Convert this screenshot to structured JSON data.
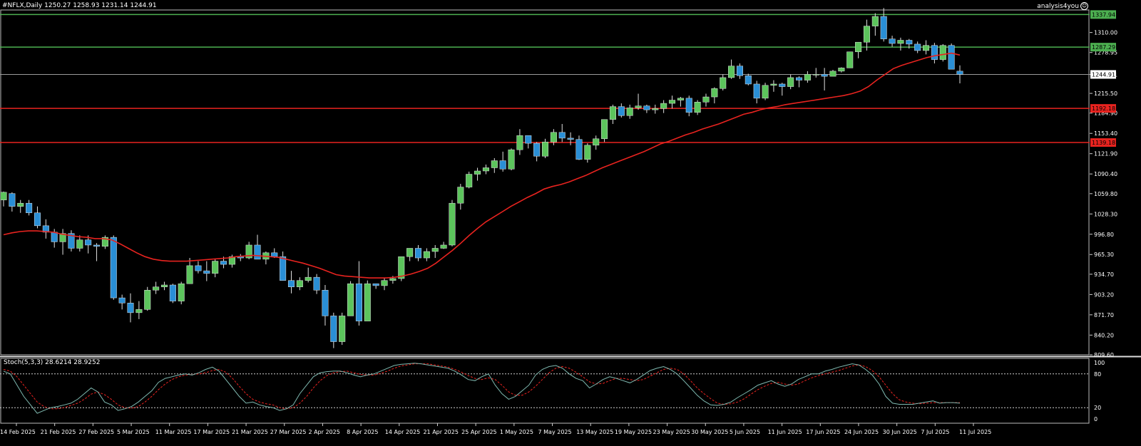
{
  "header": {
    "symbol_label": "#NFLX,Daily",
    "ohlc": "1250.27 1258.93 1231.14 1244.91",
    "brand": "analysis4you",
    "brand_icon": "smiley-icon"
  },
  "colors": {
    "background": "#000000",
    "bull_candle": "#5cc45c",
    "bear_candle": "#2a8fd6",
    "ma_line": "#e8231f",
    "support_line": "#e8231f",
    "resistance_line": "#4caf50",
    "current_price_line": "#9a9a9a",
    "stoch_main": "#7fb9b0",
    "stoch_signal": "#e8231f",
    "grid_dotted": "#cfcfcf"
  },
  "chart_data": [
    {
      "type": "candlestick",
      "title": "#NFLX,Daily",
      "ylim": [
        809.6,
        1345
      ],
      "y_ticks": [
        "1310.00",
        "1278.95",
        "1244.91",
        "1215.50",
        "1184.90",
        "1153.40",
        "1121.90",
        "1090.40",
        "1059.80",
        "1028.30",
        "996.80",
        "965.30",
        "934.70",
        "903.20",
        "871.70",
        "840.20",
        "809.60"
      ],
      "horizontal_levels": [
        {
          "label": "1337.94",
          "value": 1337.94,
          "role": "resistance"
        },
        {
          "label": "1287.29",
          "value": 1287.29,
          "role": "resistance"
        },
        {
          "label": "1244.91",
          "value": 1244.91,
          "role": "current"
        },
        {
          "label": "1192.18",
          "value": 1192.18,
          "role": "support"
        },
        {
          "label": "1139.18",
          "value": 1139.18,
          "role": "support"
        }
      ],
      "x_labels": [
        "14 Feb 2025",
        "21 Feb 2025",
        "27 Feb 2025",
        "5 Mar 2025",
        "11 Mar 2025",
        "17 Mar 2025",
        "21 Mar 2025",
        "27 Mar 2025",
        "2 Apr 2025",
        "8 Apr 2025",
        "14 Apr 2025",
        "21 Apr 2025",
        "25 Apr 2025",
        "1 May 2025",
        "7 May 2025",
        "13 May 2025",
        "19 May 2025",
        "23 May 2025",
        "30 May 2025",
        "5 Jun 2025",
        "11 Jun 2025",
        "17 Jun 2025",
        "24 Jun 2025",
        "30 Jun 2025",
        "7 Jul 2025",
        "11 Jul 2025"
      ],
      "candles": [
        [
          1050,
          1063,
          1040,
          1062
        ],
        [
          1060,
          1062,
          1032,
          1040
        ],
        [
          1040,
          1050,
          1030,
          1045
        ],
        [
          1045,
          1050,
          1026,
          1030
        ],
        [
          1030,
          1040,
          1006,
          1010
        ],
        [
          1010,
          1020,
          990,
          1000
        ],
        [
          1000,
          1005,
          976,
          985
        ],
        [
          985,
          1005,
          965,
          998
        ],
        [
          998,
          1003,
          970,
          975
        ],
        [
          975,
          995,
          970,
          988
        ],
        [
          988,
          995,
          967,
          980
        ],
        [
          980,
          983,
          955,
          978
        ],
        [
          978,
          995,
          974,
          992
        ],
        [
          992,
          995,
          895,
          898
        ],
        [
          898,
          903,
          880,
          890
        ],
        [
          890,
          905,
          860,
          875
        ],
        [
          875,
          893,
          865,
          880
        ],
        [
          880,
          915,
          878,
          910
        ],
        [
          910,
          923,
          904,
          915
        ],
        [
          915,
          923,
          910,
          918
        ],
        [
          918,
          920,
          890,
          893
        ],
        [
          893,
          923,
          888,
          920
        ],
        [
          920,
          960,
          920,
          948
        ],
        [
          948,
          955,
          936,
          940
        ],
        [
          940,
          955,
          924,
          936
        ],
        [
          936,
          958,
          930,
          955
        ],
        [
          955,
          962,
          944,
          950
        ],
        [
          950,
          965,
          945,
          962
        ],
        [
          962,
          966,
          955,
          960
        ],
        [
          960,
          985,
          958,
          980
        ],
        [
          980,
          996,
          958,
          958
        ],
        [
          958,
          970,
          950,
          968
        ],
        [
          968,
          975,
          960,
          962
        ],
        [
          962,
          970,
          925,
          925
        ],
        [
          925,
          940,
          905,
          915
        ],
        [
          915,
          930,
          910,
          925
        ],
        [
          925,
          945,
          922,
          930
        ],
        [
          930,
          935,
          904,
          910
        ],
        [
          910,
          918,
          855,
          870
        ],
        [
          870,
          875,
          820,
          830
        ],
        [
          830,
          875,
          825,
          870
        ],
        [
          870,
          924,
          870,
          920
        ],
        [
          920,
          955,
          855,
          862
        ],
        [
          862,
          925,
          910,
          920
        ],
        [
          920,
          920,
          912,
          917
        ],
        [
          917,
          929,
          910,
          925
        ],
        [
          925,
          932,
          920,
          928
        ],
        [
          928,
          960,
          924,
          962
        ],
        [
          962,
          975,
          955,
          975
        ],
        [
          975,
          980,
          955,
          960
        ],
        [
          960,
          975,
          955,
          970
        ],
        [
          970,
          980,
          960,
          975
        ],
        [
          975,
          985,
          974,
          980
        ],
        [
          980,
          1050,
          978,
          1045
        ],
        [
          1045,
          1075,
          1035,
          1070
        ],
        [
          1070,
          1094,
          1068,
          1090
        ],
        [
          1090,
          1100,
          1080,
          1095
        ],
        [
          1095,
          1105,
          1090,
          1100
        ],
        [
          1100,
          1115,
          1092,
          1111
        ],
        [
          1111,
          1125,
          1094,
          1098
        ],
        [
          1098,
          1130,
          1096,
          1128
        ],
        [
          1128,
          1160,
          1120,
          1150
        ],
        [
          1150,
          1145,
          1130,
          1138
        ],
        [
          1138,
          1140,
          1110,
          1118
        ],
        [
          1118,
          1145,
          1115,
          1140
        ],
        [
          1140,
          1160,
          1135,
          1155
        ],
        [
          1155,
          1168,
          1140,
          1146
        ],
        [
          1146,
          1155,
          1135,
          1144
        ],
        [
          1144,
          1150,
          1112,
          1113
        ],
        [
          1113,
          1138,
          1108,
          1135
        ],
        [
          1135,
          1150,
          1128,
          1145
        ],
        [
          1145,
          1175,
          1140,
          1175
        ],
        [
          1175,
          1198,
          1168,
          1195
        ],
        [
          1195,
          1200,
          1178,
          1181
        ],
        [
          1181,
          1198,
          1176,
          1193
        ],
        [
          1193,
          1215,
          1190,
          1196
        ],
        [
          1196,
          1198,
          1185,
          1190
        ],
        [
          1190,
          1198,
          1184,
          1192
        ],
        [
          1192,
          1205,
          1185,
          1200
        ],
        [
          1200,
          1212,
          1192,
          1205
        ],
        [
          1205,
          1210,
          1195,
          1208
        ],
        [
          1208,
          1212,
          1180,
          1186
        ],
        [
          1186,
          1205,
          1182,
          1202
        ],
        [
          1202,
          1215,
          1195,
          1210
        ],
        [
          1210,
          1225,
          1200,
          1223
        ],
        [
          1223,
          1245,
          1220,
          1240
        ],
        [
          1240,
          1268,
          1238,
          1258
        ],
        [
          1258,
          1262,
          1238,
          1243
        ],
        [
          1243,
          1246,
          1228,
          1230
        ],
        [
          1230,
          1235,
          1200,
          1208
        ],
        [
          1208,
          1232,
          1205,
          1228
        ],
        [
          1228,
          1236,
          1218,
          1230
        ],
        [
          1230,
          1232,
          1212,
          1226
        ],
        [
          1226,
          1245,
          1222,
          1240
        ],
        [
          1240,
          1242,
          1225,
          1236
        ],
        [
          1236,
          1250,
          1232,
          1245
        ],
        [
          1245,
          1255,
          1240,
          1245
        ],
        [
          1245,
          1255,
          1220,
          1242
        ],
        [
          1242,
          1252,
          1245,
          1250
        ],
        [
          1250,
          1256,
          1248,
          1255
        ],
        [
          1255,
          1280,
          1255,
          1280
        ],
        [
          1280,
          1295,
          1270,
          1295
        ],
        [
          1295,
          1330,
          1282,
          1320
        ],
        [
          1320,
          1340,
          1305,
          1335
        ],
        [
          1335,
          1348,
          1296,
          1300
        ],
        [
          1300,
          1305,
          1288,
          1293
        ],
        [
          1293,
          1302,
          1282,
          1298
        ],
        [
          1298,
          1300,
          1285,
          1292
        ],
        [
          1292,
          1296,
          1278,
          1282
        ],
        [
          1282,
          1298,
          1276,
          1290
        ],
        [
          1290,
          1294,
          1262,
          1268
        ],
        [
          1268,
          1292,
          1265,
          1290
        ],
        [
          1290,
          1293,
          1255,
          1253
        ],
        [
          1250,
          1259,
          1231,
          1245
        ]
      ],
      "series": [
        {
          "name": "MA",
          "values": [
            996,
            999,
            1001,
            1002,
            1002,
            1001,
            1000,
            997,
            995,
            993,
            992,
            990,
            990,
            988,
            982,
            975,
            968,
            962,
            958,
            956,
            955,
            955,
            955,
            956,
            957,
            958,
            959,
            960,
            962,
            963,
            964,
            963,
            962,
            961,
            958,
            955,
            952,
            948,
            944,
            939,
            934,
            932,
            931,
            930,
            929,
            929,
            929,
            930,
            932,
            935,
            939,
            944,
            952,
            962,
            972,
            983,
            995,
            1006,
            1016,
            1024,
            1032,
            1040,
            1047,
            1054,
            1060,
            1067,
            1071,
            1074,
            1078,
            1083,
            1088,
            1094,
            1100,
            1105,
            1110,
            1115,
            1120,
            1125,
            1131,
            1137,
            1141,
            1146,
            1151,
            1155,
            1160,
            1164,
            1168,
            1173,
            1178,
            1183,
            1186,
            1190,
            1193,
            1195,
            1198,
            1200,
            1202,
            1204,
            1206,
            1208,
            1210,
            1212,
            1215,
            1219,
            1226,
            1236,
            1245,
            1254,
            1259,
            1263,
            1267,
            1271,
            1274,
            1276,
            1278,
            1275
          ]
        }
      ]
    },
    {
      "type": "line",
      "title": "Stoch(5,3,3) 28.6214 28.9252",
      "ylim": [
        0,
        100
      ],
      "y_ticks": [
        "100",
        "80",
        "20",
        "0"
      ],
      "levels": [
        80,
        20
      ],
      "series": [
        {
          "name": "main",
          "values": [
            85,
            80,
            60,
            40,
            25,
            10,
            15,
            20,
            22,
            25,
            28,
            35,
            45,
            55,
            48,
            30,
            25,
            15,
            18,
            22,
            30,
            40,
            50,
            65,
            72,
            75,
            78,
            80,
            78,
            82,
            88,
            92,
            85,
            70,
            55,
            40,
            28,
            30,
            25,
            22,
            20,
            15,
            18,
            25,
            45,
            60,
            75,
            82,
            84,
            85,
            85,
            82,
            78,
            75,
            78,
            80,
            85,
            90,
            95,
            97,
            98,
            99,
            98,
            96,
            94,
            92,
            90,
            85,
            78,
            70,
            68,
            75,
            80,
            60,
            45,
            35,
            40,
            50,
            60,
            78,
            88,
            93,
            95,
            90,
            80,
            72,
            68,
            55,
            62,
            70,
            75,
            72,
            68,
            64,
            70,
            78,
            86,
            90,
            93,
            88,
            80,
            68,
            55,
            42,
            32,
            25,
            24,
            26,
            30,
            38,
            45,
            52,
            60,
            64,
            68,
            62,
            58,
            62,
            70,
            75,
            80,
            80,
            85,
            88,
            92,
            95,
            98,
            96,
            88,
            78,
            62,
            40,
            28,
            26,
            26,
            26,
            28,
            30,
            32,
            28,
            29,
            29,
            28
          ]
        },
        {
          "name": "signal",
          "values": [
            88,
            85,
            75,
            60,
            45,
            30,
            22,
            18,
            18,
            20,
            24,
            28,
            35,
            44,
            48,
            43,
            35,
            25,
            20,
            19,
            22,
            30,
            40,
            52,
            62,
            70,
            75,
            78,
            79,
            80,
            82,
            86,
            88,
            83,
            72,
            58,
            45,
            35,
            30,
            27,
            25,
            20,
            18,
            20,
            28,
            40,
            55,
            68,
            77,
            82,
            84,
            85,
            82,
            79,
            78,
            78,
            81,
            85,
            90,
            94,
            96,
            98,
            98,
            98,
            96,
            94,
            92,
            88,
            83,
            77,
            72,
            70,
            73,
            70,
            60,
            48,
            42,
            42,
            48,
            58,
            70,
            82,
            90,
            93,
            90,
            83,
            75,
            66,
            62,
            63,
            68,
            72,
            72,
            70,
            68,
            70,
            76,
            82,
            88,
            90,
            88,
            80,
            68,
            55,
            45,
            36,
            28,
            26,
            27,
            30,
            36,
            44,
            52,
            58,
            63,
            65,
            62,
            60,
            62,
            68,
            73,
            77,
            80,
            83,
            86,
            90,
            94,
            96,
            93,
            86,
            75,
            60,
            45,
            34,
            30,
            28,
            27,
            28,
            29,
            29,
            29,
            29,
            29
          ]
        }
      ]
    }
  ]
}
